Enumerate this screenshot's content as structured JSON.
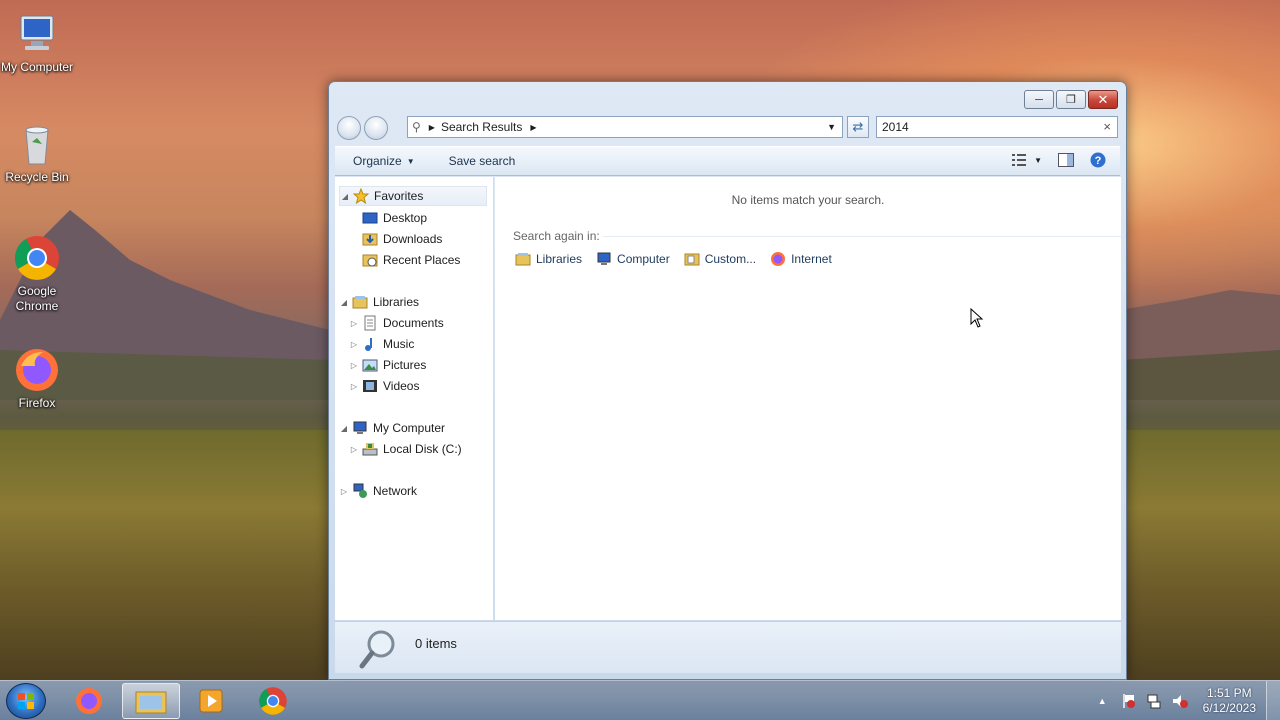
{
  "desktop": {
    "icons": [
      {
        "label": "My Computer"
      },
      {
        "label": "Recycle Bin"
      },
      {
        "label": "Google Chrome"
      },
      {
        "label": "Firefox"
      }
    ]
  },
  "window": {
    "address": {
      "segment": "Search Results"
    },
    "search": {
      "value": "2014"
    },
    "toolbar": {
      "organize": "Organize",
      "save_search": "Save search"
    },
    "nav": {
      "favorites": "Favorites",
      "desktop": "Desktop",
      "downloads": "Downloads",
      "recent_places": "Recent Places",
      "libraries": "Libraries",
      "documents": "Documents",
      "music": "Music",
      "pictures": "Pictures",
      "videos": "Videos",
      "my_computer": "My Computer",
      "local_disk": "Local Disk (C:)",
      "network": "Network"
    },
    "content": {
      "no_items": "No items match your search.",
      "search_again": "Search again in:",
      "options": [
        "Libraries",
        "Computer",
        "Custom...",
        "Internet"
      ]
    },
    "status": {
      "count": "0 items"
    }
  },
  "taskbar": {
    "clock_time": "1:51 PM",
    "clock_date": "6/12/2023"
  }
}
